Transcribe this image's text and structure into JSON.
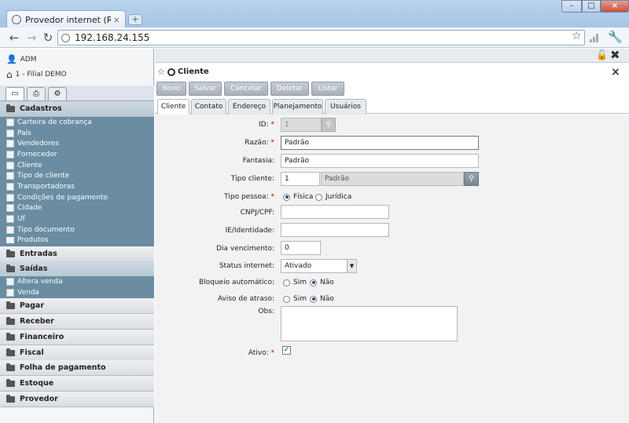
{
  "browser": {
    "tab_title": "Provedor internet (Radius)",
    "tab_close": "×",
    "new_tab": "+",
    "url": "192.168.24.155",
    "min": "–",
    "max": "□",
    "close": "×"
  },
  "sidebar": {
    "user": "ADM",
    "branch": "1 - Filial DEMO",
    "sections": {
      "cadastros": "Cadastros",
      "entradas": "Entradas",
      "saidas": "Saídas",
      "pagar": "Pagar",
      "receber": "Receber",
      "financeiro": "Financeiro",
      "fiscal": "Fiscal",
      "folha": "Folha de pagamento",
      "estoque": "Estoque",
      "provedor": "Provedor"
    },
    "cadastros_items": [
      "Carteira de cobrança",
      "País",
      "Vendedores",
      "Fornecedor",
      "Cliente",
      "Tipo de cliente",
      "Transportadoras",
      "Condições de pagamento",
      "Cidade",
      "Uf",
      "Tipo documento",
      "Produtos"
    ],
    "saidas_items": [
      "Altera venda",
      "Venda"
    ]
  },
  "panel": {
    "title": "Cliente",
    "close": "×",
    "buttons": {
      "novo": "Novo",
      "salvar": "Salvar",
      "cancelar": "Cancelar",
      "deletar": "Deletar",
      "listar": "Listar"
    },
    "tabs": [
      "Cliente",
      "Contato",
      "Endereço",
      "Planejamento",
      "Usuários"
    ]
  },
  "form": {
    "id_label": "ID:",
    "id_value": "1",
    "razao_label": "Razão:",
    "razao_value": "Padrão",
    "fantasia_label": "Fantasia:",
    "fantasia_value": "Padrão",
    "tipo_cliente_label": "Tipo cliente:",
    "tipo_cliente_value": "1",
    "tipo_cliente_desc": "Padrão",
    "tipo_pessoa_label": "Tipo pessoa:",
    "tipo_pessoa_opts": [
      "Física",
      "Jurídica"
    ],
    "cnpj_label": "CNPJ/CPF:",
    "ie_label": "IE/Identidade:",
    "dia_label": "Dia vencimento:",
    "dia_value": "0",
    "status_label": "Status internet:",
    "status_value": "Ativado",
    "bloqueio_label": "Bloqueio automático:",
    "aviso_label": "Aviso de atraso:",
    "sim": "Sim",
    "nao": "Não",
    "obs_label": "Obs:",
    "ativo_label": "Ativo:",
    "req_mark": "*"
  }
}
